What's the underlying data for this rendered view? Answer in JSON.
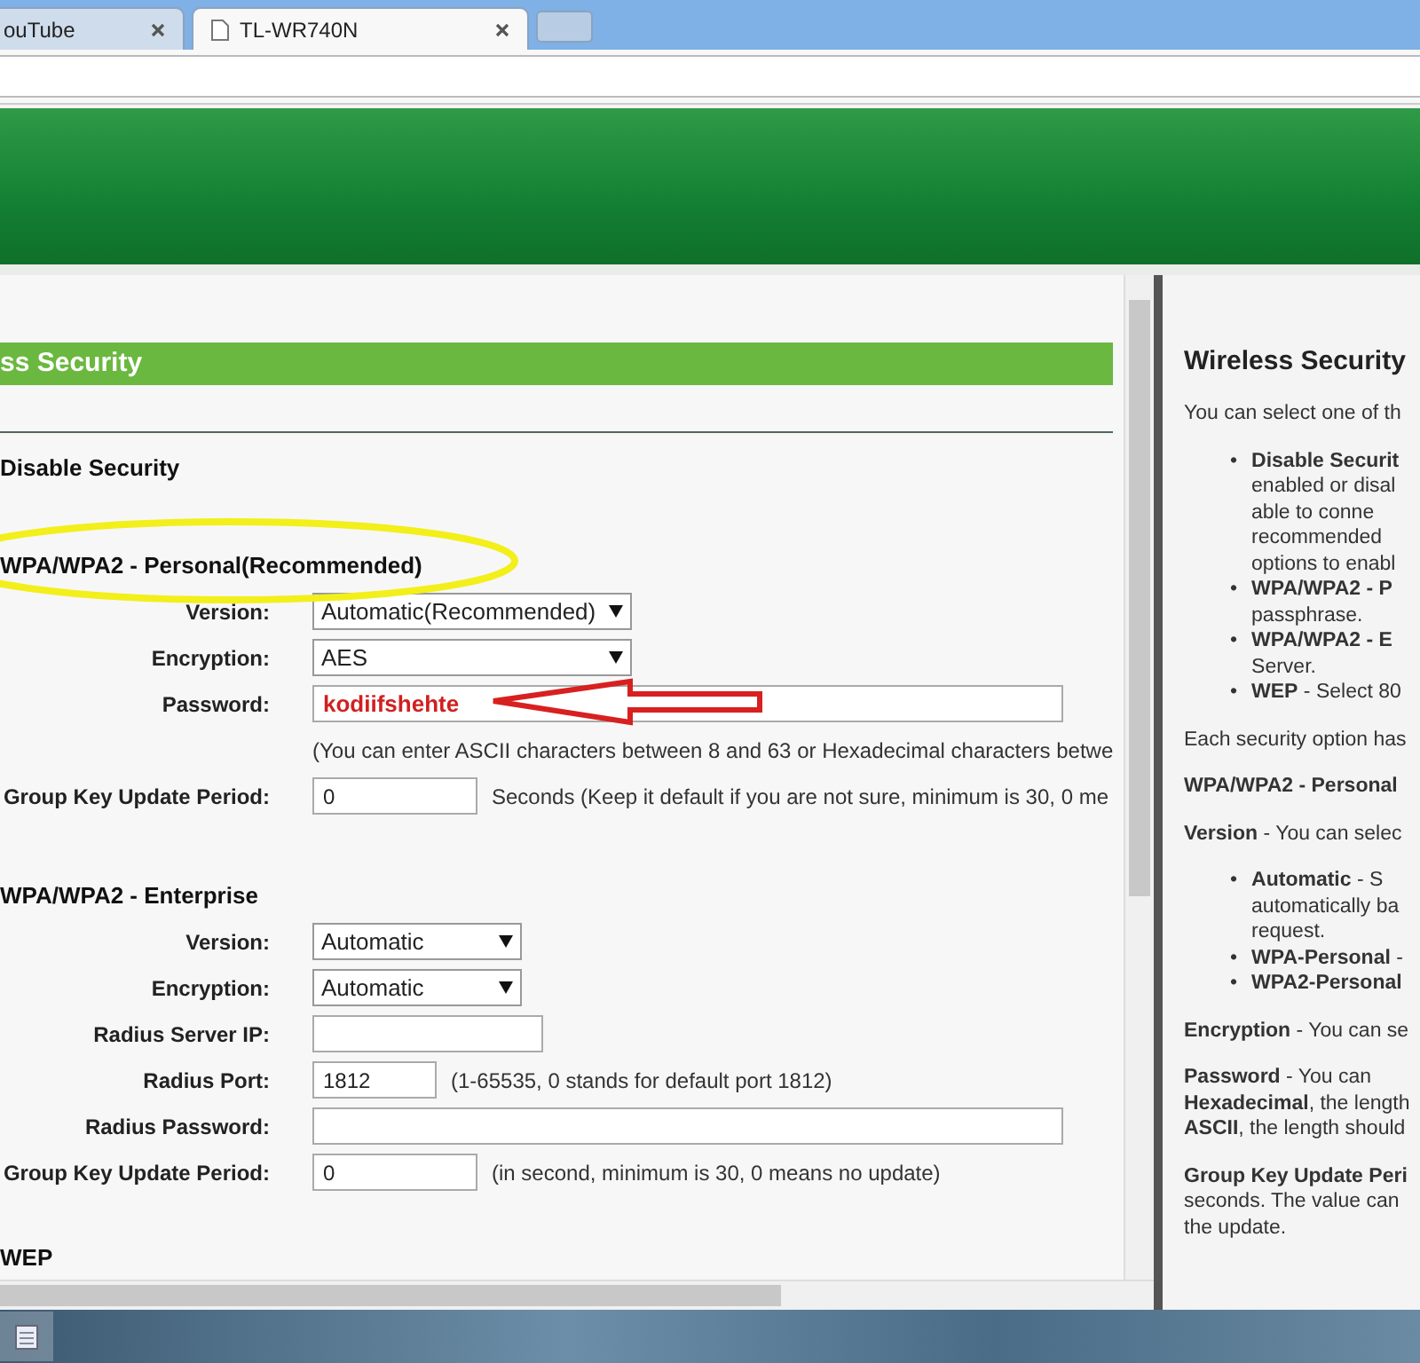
{
  "browser": {
    "tabs": [
      {
        "title": "ouTube",
        "selected": false
      },
      {
        "title": "TL-WR740N",
        "selected": true
      }
    ]
  },
  "section_title": "ss Security",
  "disable_option": {
    "label": "Disable Security"
  },
  "personal": {
    "heading": "WPA/WPA2 - Personal(Recommended)",
    "fields": [
      {
        "kind": "wide-select",
        "label": "Version:",
        "value": "Automatic(Recommended)"
      },
      {
        "kind": "wide-select",
        "label": "Encryption:",
        "value": "AES"
      },
      {
        "kind": "wide-input",
        "label": "Password:",
        "value": "kodiifshehte",
        "emphasized": true
      },
      {
        "kind": "note",
        "note": "(You can enter ASCII characters between 8 and 63 or Hexadecimal characters betwe"
      },
      {
        "kind": "input",
        "label": "Group Key Update Period:",
        "value": "0",
        "note": "Seconds (Keep it default if you are not sure, minimum is 30, 0 me"
      }
    ]
  },
  "enterprise": {
    "heading": "WPA/WPA2 - Enterprise",
    "fields": [
      {
        "kind": "select",
        "label": "Version:",
        "value": "Automatic"
      },
      {
        "kind": "select",
        "label": "Encryption:",
        "value": "Automatic"
      },
      {
        "kind": "ip-input",
        "label": "Radius Server IP:"
      },
      {
        "kind": "short-input",
        "label": "Radius Port:",
        "value": "1812",
        "note": "(1-65535, 0 stands for default port 1812)"
      },
      {
        "kind": "wide-input",
        "label": "Radius Password:"
      },
      {
        "kind": "input",
        "label": "Group Key Update Period:",
        "value": "0",
        "note": "(in second, minimum is 30, 0 means no update)"
      }
    ]
  },
  "wep": {
    "heading": "WEP"
  },
  "help": {
    "title": "Wireless Security",
    "blocks": [
      {
        "kind": "para",
        "lines": [
          "You can select one of th"
        ]
      },
      {
        "kind": "bullets",
        "marker": "•",
        "items": [
          [
            "**Disable Securit**",
            "enabled or disal",
            "able  to  conne",
            "recommended",
            "options to enabl"
          ],
          [
            "**WPA/WPA2 - P**",
            "passphrase."
          ],
          [
            "**WPA/WPA2 - E**",
            "Server."
          ],
          [
            "**WEP** - Select 80"
          ]
        ]
      },
      {
        "kind": "para",
        "lines": [
          "Each security option has"
        ]
      },
      {
        "kind": "para",
        "lines": [
          "**WPA/WPA2 - Personal**"
        ]
      },
      {
        "kind": "para",
        "lines": [
          "**Version** -  You can selec"
        ]
      },
      {
        "kind": "bullets",
        "marker": "•",
        "items": [
          [
            "**Automatic**  -  S",
            "automatically ba",
            "request."
          ],
          [
            "**WPA-Personal** -"
          ],
          [
            "**WPA2-Personal**"
          ]
        ]
      },
      {
        "kind": "para",
        "lines": [
          "**Encryption** - You can se"
        ]
      },
      {
        "kind": "para",
        "lines": [
          "**Password** - You can",
          "**Hexadecimal**, the length",
          "**ASCII**, the length should"
        ]
      },
      {
        "kind": "para",
        "lines": [
          "**Group Key Update Peri**",
          "seconds. The value can",
          "the update."
        ]
      }
    ]
  }
}
